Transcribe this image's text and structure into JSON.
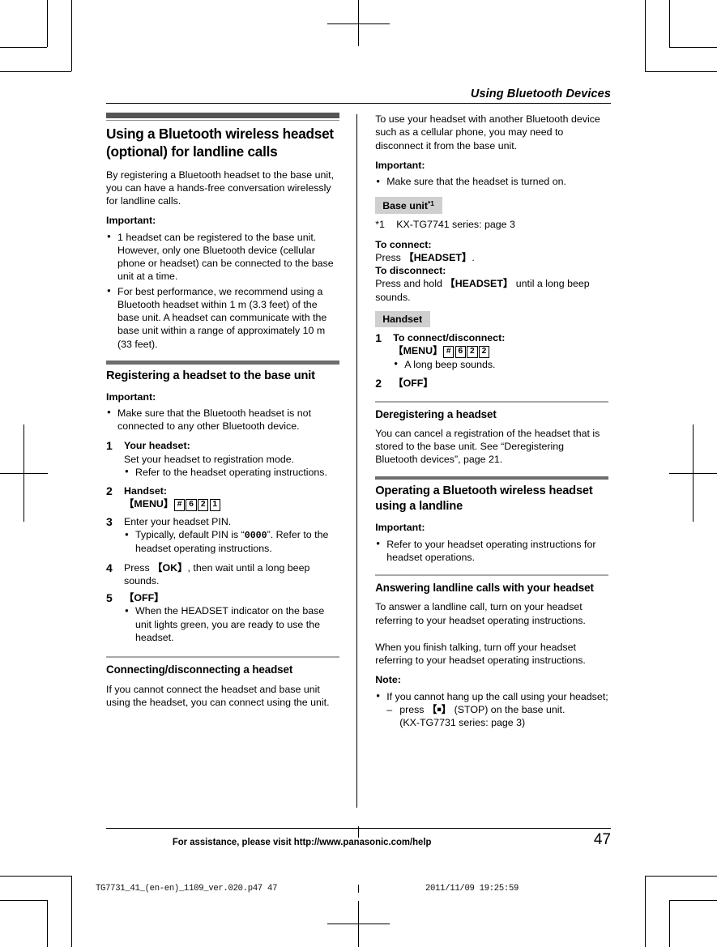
{
  "running_head": "Using Bluetooth Devices",
  "left_column": {
    "section1": {
      "heading": "Using a Bluetooth wireless headset (optional) for landline calls",
      "intro": "By registering a Bluetooth headset to the base unit, you can have a hands-free conversation wirelessly for landline calls.",
      "important_label": "Important:",
      "important_bullets": [
        "1 headset can be registered to the base unit. However, only one Bluetooth device (cellular phone or headset) can be connected to the base unit at a time.",
        "For best performance, we recommend using a Bluetooth headset within 1 m (3.3 feet) of the base unit. A headset can communicate with the base unit within a range of approximately 10 m (33 feet)."
      ]
    },
    "section2": {
      "heading": "Registering a headset to the base unit",
      "important_label": "Important:",
      "important_bullets": [
        "Make sure that the Bluetooth headset is not connected to any other Bluetooth device."
      ],
      "steps": [
        {
          "num": "1",
          "title": "Your headset:",
          "text": "Set your headset to registration mode.",
          "bullets": [
            "Refer to the headset operating instructions."
          ]
        },
        {
          "num": "2",
          "title": "Handset:",
          "keys_prefix": "MENU",
          "keys": [
            "#",
            "6",
            "2",
            "1"
          ],
          "bullets": []
        },
        {
          "num": "3",
          "title": "",
          "text": "Enter your headset PIN.",
          "bullets": [
            "Typically, default PIN is “0000”. Refer to the headset operating instructions."
          ],
          "bullet_code": "0000"
        },
        {
          "num": "4",
          "title": "",
          "text_before_key": "Press ",
          "key": "OK",
          "text_after_key": ", then wait until a long beep sounds.",
          "bullets": []
        },
        {
          "num": "5",
          "title": "",
          "key_only": "OFF",
          "bullets": [
            "When the HEADSET indicator on the base unit lights green, you are ready to use the headset."
          ]
        }
      ]
    },
    "section3": {
      "heading": "Connecting/disconnecting a headset",
      "text": "If you cannot connect the headset and base unit using the headset, you can connect using the unit."
    }
  },
  "right_column": {
    "continued": {
      "text": "To use your headset with another Bluetooth device such as a cellular phone, you may need to disconnect it from the base unit.",
      "important_label": "Important:",
      "important_bullets": [
        "Make sure that the headset is turned on."
      ],
      "tag_base_unit": "Base unit",
      "tag_base_unit_sup": "*1",
      "footnote_mark": "*1",
      "footnote_text": "KX-TG7741 series: page 3",
      "to_connect_label": "To connect:",
      "to_connect_text_before": "Press ",
      "to_connect_key": "HEADSET",
      "to_connect_text_after": ".",
      "to_disconnect_label": "To disconnect:",
      "to_disconnect_text_before": "Press and hold ",
      "to_disconnect_key": "HEADSET",
      "to_disconnect_text_after": " until a long beep sounds.",
      "tag_handset": "Handset",
      "steps": [
        {
          "num": "1",
          "title": "To connect/disconnect:",
          "keys_prefix": "MENU",
          "keys": [
            "#",
            "6",
            "2",
            "2"
          ],
          "bullets": [
            "A long beep sounds."
          ]
        },
        {
          "num": "2",
          "key_only": "OFF",
          "bullets": []
        }
      ]
    },
    "section_dereg": {
      "heading": "Deregistering a headset",
      "text": "You can cancel a registration of the headset that is stored to the base unit. See “Deregistering Bluetooth devices”, page 21."
    },
    "section_operating": {
      "heading": "Operating a Bluetooth wireless headset using a landline",
      "important_label": "Important:",
      "important_bullets": [
        "Refer to your headset operating instructions for headset operations."
      ]
    },
    "section_answering": {
      "heading": "Answering landline calls with your headset",
      "paragraph1": "To answer a landline call, turn on your headset referring to your headset operating instructions.",
      "paragraph2": "When you finish talking, turn off your headset referring to your headset operating instructions.",
      "note_label": "Note:",
      "note_bullets": [
        "If you cannot hang up the call using your headset;"
      ],
      "note_dash_before": "press ",
      "note_dash_key": "■",
      "note_dash_after": " (STOP) on the base unit.",
      "note_dash_line2": "(KX-TG7731 series: page 3)"
    }
  },
  "footer": {
    "text": "For assistance, please visit http://www.panasonic.com/help",
    "page_number": "47"
  },
  "print_slug": {
    "left": "TG7731_41_(en-en)_1109_ver.020.p47   47",
    "right": "2011/11/09   19:25:59"
  },
  "colors": {
    "h1_bar": "#555555",
    "h2_bar": "#6e6e6e",
    "h3_rule": "#a9a9a9",
    "tag_bg": "#cfcfcf"
  }
}
